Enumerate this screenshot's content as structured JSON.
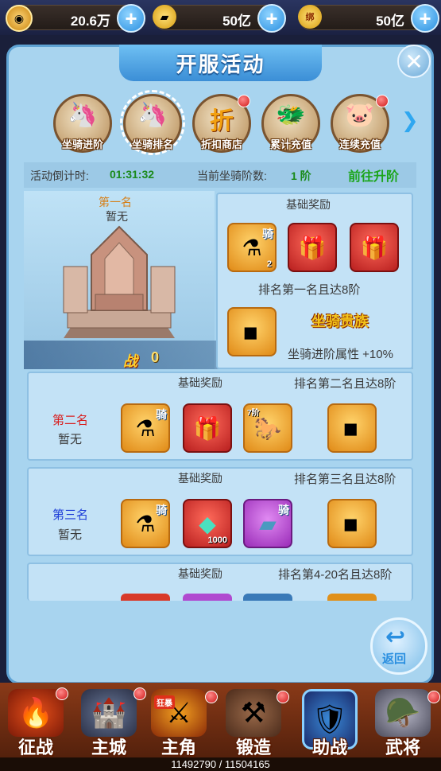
{
  "currency": [
    {
      "icon": "coin-icon",
      "value": "20.6万"
    },
    {
      "icon": "gold-ingot-icon",
      "value": "50亿"
    },
    {
      "icon": "bound-ingot-icon",
      "badge": "绑",
      "value": "50亿"
    }
  ],
  "panel": {
    "title": "开服活动"
  },
  "activities": [
    {
      "label": "坐骑进阶",
      "glyph": "🦄",
      "has_dot": false,
      "selected": false
    },
    {
      "label": "坐骑排名",
      "glyph": "🦄",
      "has_dot": false,
      "selected": true
    },
    {
      "label": "折扣商店",
      "glyph": "折",
      "has_dot": true,
      "selected": false
    },
    {
      "label": "累计充值",
      "glyph": "🐲",
      "has_dot": false,
      "selected": false
    },
    {
      "label": "连续充值",
      "glyph": "🐷",
      "has_dot": true,
      "selected": false
    }
  ],
  "info": {
    "countdown_label": "活动倒计时:",
    "countdown_value": "01:31:32",
    "level_label": "当前坐骑阶数:",
    "level_value": "1 阶",
    "go_button": "前往升阶"
  },
  "first": {
    "rank": "第一名",
    "player": "暂无",
    "power_icon": "战",
    "power_value": "0",
    "base_reward_title": "基础奖励",
    "requirement": "排名第一名且达8阶",
    "extra_title": "坐骑贵族",
    "extra_bonus": "坐骑进阶属性 +10%",
    "items": [
      {
        "type": "potion",
        "tag": "骑",
        "qty": "2",
        "color": "gold"
      },
      {
        "type": "chest",
        "color": "red"
      },
      {
        "type": "chest",
        "color": "red"
      }
    ],
    "title_item": {
      "type": "token",
      "color": "gold"
    }
  },
  "rows": [
    {
      "rank": "第二名",
      "rank_color": "#d81e1e",
      "player": "暂无",
      "reward_title": "基础奖励",
      "requirement": "排名第二名且达8阶",
      "items": [
        {
          "type": "potion",
          "tag": "骑",
          "color": "gold"
        },
        {
          "type": "chest",
          "color": "red"
        },
        {
          "type": "saddle",
          "level": "7阶",
          "color": "gold"
        }
      ],
      "title_item": {
        "type": "token",
        "color": "gold"
      }
    },
    {
      "rank": "第三名",
      "rank_color": "#1f3fd8",
      "player": "暂无",
      "reward_title": "基础奖励",
      "requirement": "排名第三名且达8阶",
      "items": [
        {
          "type": "potion",
          "tag": "骑",
          "color": "gold"
        },
        {
          "type": "jade",
          "qty": "1000",
          "color": "red"
        },
        {
          "type": "crystal",
          "tag": "骑",
          "color": "purple"
        }
      ],
      "title_item": {
        "type": "token",
        "color": "gold"
      }
    },
    {
      "rank": "",
      "player": "",
      "reward_title": "基础奖励",
      "requirement": "排名第4-20名且达8阶",
      "items": [],
      "title_item": null
    }
  ],
  "return_label": "返回",
  "nav": [
    {
      "label": "征战",
      "glyph": "🔥",
      "has_dot": true
    },
    {
      "label": "主城",
      "glyph": "🏰",
      "has_dot": true
    },
    {
      "label": "主角",
      "glyph": "⚔",
      "has_dot": true,
      "badge": "狂暴"
    },
    {
      "label": "锻造",
      "glyph": "⚒",
      "has_dot": true
    },
    {
      "label": "助战",
      "glyph": "🛡",
      "has_dot": false,
      "selected": true
    },
    {
      "label": "武将",
      "glyph": "🪖",
      "has_dot": true
    }
  ],
  "exp": "11492790 / 11504165"
}
